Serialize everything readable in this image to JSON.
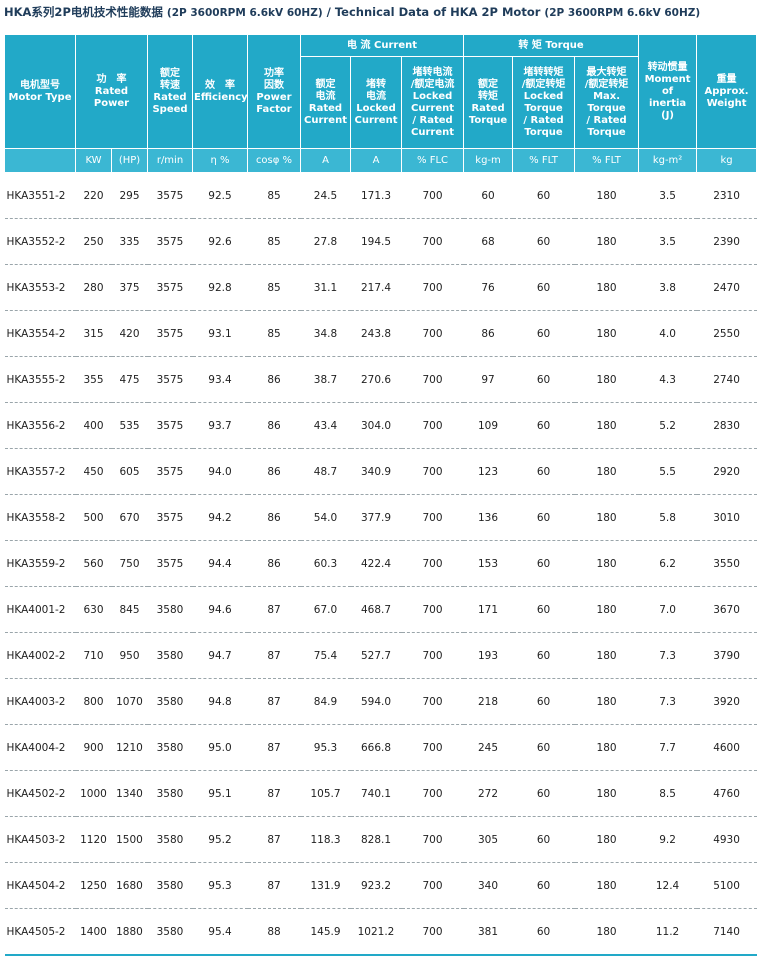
{
  "title": {
    "main": "HKA系列2P电机技术性能数据",
    "spec": "(2P 3600RPM 6.6kV 60HZ)",
    "sep": " / ",
    "en": "Technical Data of HKA 2P Motor",
    "spec_en": "(2P 3600RPM 6.6kV 60HZ)"
  },
  "headers": {
    "motor_type": [
      "电机型号",
      "Motor Type"
    ],
    "rated_power": [
      "功　率",
      "Rated Power"
    ],
    "rated_speed": [
      "额定",
      "转速",
      "Rated",
      "Speed"
    ],
    "efficiency": [
      "效　率",
      "Efficiency"
    ],
    "power_factor": [
      "功率",
      "因数",
      "Power",
      "Factor"
    ],
    "current_group": "电 流 Current",
    "rated_current": [
      "额定",
      "电流",
      "Rated",
      "Current"
    ],
    "locked_current": [
      "堵转",
      "电流",
      "Locked",
      "Current"
    ],
    "locked_rated_current": [
      "堵转电流",
      "/额定电流",
      "Locked",
      "Current",
      "/ Rated",
      "Current"
    ],
    "torque_group": "转 矩 Torque",
    "rated_torque": [
      "额定",
      "转矩",
      "Rated",
      "Torque"
    ],
    "locked_torque": [
      "堵转转矩",
      "/额定转矩",
      "Locked",
      "Torque",
      "/ Rated",
      "Torque"
    ],
    "max_torque": [
      "最大转矩",
      "/额定转矩",
      "Max.",
      "Torque",
      "/ Rated",
      "Torque"
    ],
    "inertia": [
      "转动惯量",
      "Moment",
      "of",
      "inertia",
      "(J)"
    ],
    "weight": [
      "重量",
      "Approx.",
      "Weight"
    ]
  },
  "units": [
    "KW",
    "(HP)",
    "r/min",
    "η %",
    "cosφ %",
    "A",
    "A",
    "% FLC",
    "kg-m",
    "% FLT",
    "% FLT",
    "kg-m²",
    "kg"
  ],
  "rows": [
    [
      "HKA3551-2",
      "220",
      "295",
      "3575",
      "92.5",
      "85",
      "24.5",
      "171.3",
      "700",
      "60",
      "60",
      "180",
      "3.5",
      "2310"
    ],
    [
      "HKA3552-2",
      "250",
      "335",
      "3575",
      "92.6",
      "85",
      "27.8",
      "194.5",
      "700",
      "68",
      "60",
      "180",
      "3.5",
      "2390"
    ],
    [
      "HKA3553-2",
      "280",
      "375",
      "3575",
      "92.8",
      "85",
      "31.1",
      "217.4",
      "700",
      "76",
      "60",
      "180",
      "3.8",
      "2470"
    ],
    [
      "HKA3554-2",
      "315",
      "420",
      "3575",
      "93.1",
      "85",
      "34.8",
      "243.8",
      "700",
      "86",
      "60",
      "180",
      "4.0",
      "2550"
    ],
    [
      "HKA3555-2",
      "355",
      "475",
      "3575",
      "93.4",
      "86",
      "38.7",
      "270.6",
      "700",
      "97",
      "60",
      "180",
      "4.3",
      "2740"
    ],
    [
      "HKA3556-2",
      "400",
      "535",
      "3575",
      "93.7",
      "86",
      "43.4",
      "304.0",
      "700",
      "109",
      "60",
      "180",
      "5.2",
      "2830"
    ],
    [
      "HKA3557-2",
      "450",
      "605",
      "3575",
      "94.0",
      "86",
      "48.7",
      "340.9",
      "700",
      "123",
      "60",
      "180",
      "5.5",
      "2920"
    ],
    [
      "HKA3558-2",
      "500",
      "670",
      "3575",
      "94.2",
      "86",
      "54.0",
      "377.9",
      "700",
      "136",
      "60",
      "180",
      "5.8",
      "3010"
    ],
    [
      "HKA3559-2",
      "560",
      "750",
      "3575",
      "94.4",
      "86",
      "60.3",
      "422.4",
      "700",
      "153",
      "60",
      "180",
      "6.2",
      "3550"
    ],
    [
      "HKA4001-2",
      "630",
      "845",
      "3580",
      "94.6",
      "87",
      "67.0",
      "468.7",
      "700",
      "171",
      "60",
      "180",
      "7.0",
      "3670"
    ],
    [
      "HKA4002-2",
      "710",
      "950",
      "3580",
      "94.7",
      "87",
      "75.4",
      "527.7",
      "700",
      "193",
      "60",
      "180",
      "7.3",
      "3790"
    ],
    [
      "HKA4003-2",
      "800",
      "1070",
      "3580",
      "94.8",
      "87",
      "84.9",
      "594.0",
      "700",
      "218",
      "60",
      "180",
      "7.3",
      "3920"
    ],
    [
      "HKA4004-2",
      "900",
      "1210",
      "3580",
      "95.0",
      "87",
      "95.3",
      "666.8",
      "700",
      "245",
      "60",
      "180",
      "7.7",
      "4600"
    ],
    [
      "HKA4502-2",
      "1000",
      "1340",
      "3580",
      "95.1",
      "87",
      "105.7",
      "740.1",
      "700",
      "272",
      "60",
      "180",
      "8.5",
      "4760"
    ],
    [
      "HKA4503-2",
      "1120",
      "1500",
      "3580",
      "95.2",
      "87",
      "118.3",
      "828.1",
      "700",
      "305",
      "60",
      "180",
      "9.2",
      "4930"
    ],
    [
      "HKA4504-2",
      "1250",
      "1680",
      "3580",
      "95.3",
      "87",
      "131.9",
      "923.2",
      "700",
      "340",
      "60",
      "180",
      "12.4",
      "5100"
    ],
    [
      "HKA4505-2",
      "1400",
      "1880",
      "3580",
      "95.4",
      "88",
      "145.9",
      "1021.2",
      "700",
      "381",
      "60",
      "180",
      "11.2",
      "7140"
    ]
  ],
  "colors": {
    "header_bg": "#22a9c8",
    "unit_bg": "#3bb7d3",
    "title_text": "#1f3c5a"
  }
}
